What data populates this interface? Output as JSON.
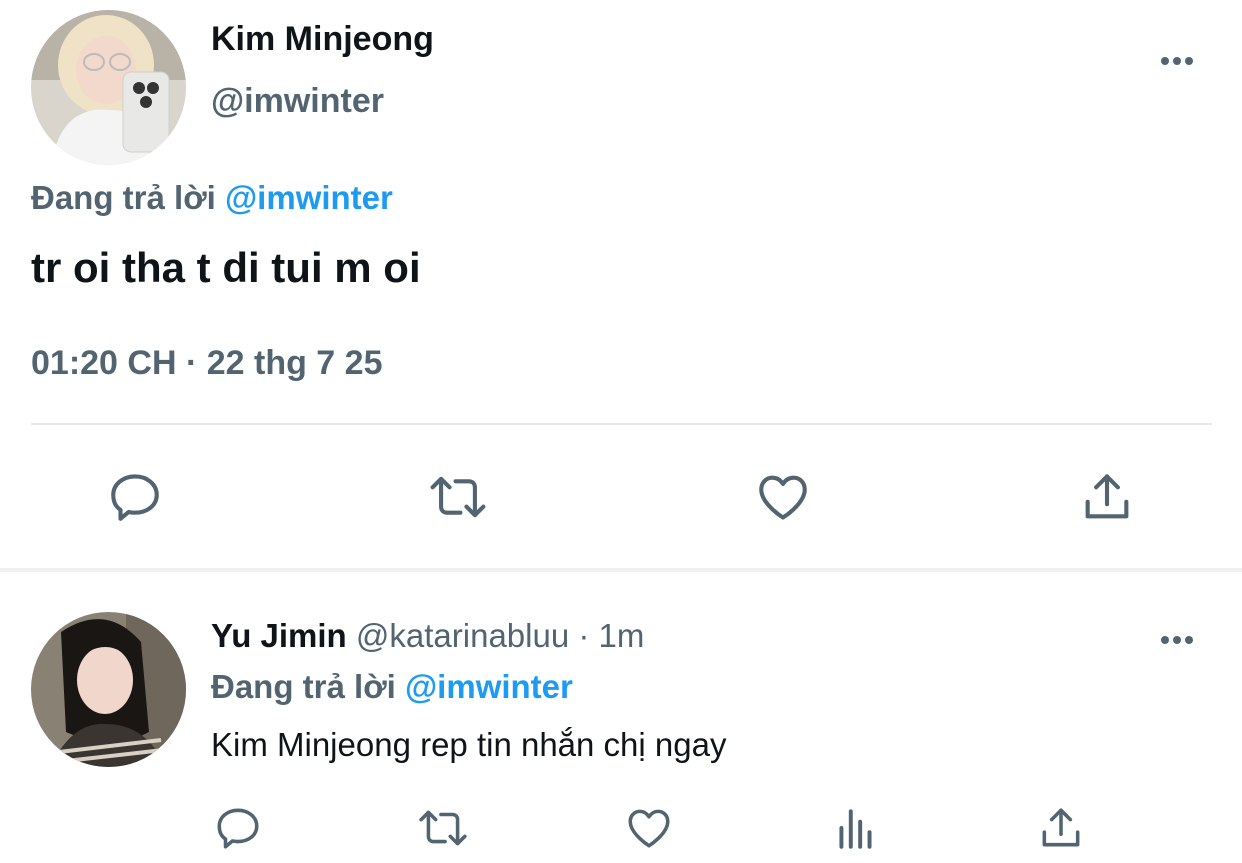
{
  "main_tweet": {
    "display_name": "Kim Minjeong",
    "handle": "@imwinter",
    "replying_prefix": "Đang trả lời",
    "replying_to": "@imwinter",
    "text": "tr oi tha t di tui m oi",
    "timestamp": "01:20 CH · 22 thg 7 25",
    "actions": [
      "reply-icon",
      "retweet-icon",
      "like-icon",
      "share-icon"
    ]
  },
  "reply_tweet": {
    "display_name": "Yu Jimin",
    "handle": "@katarinabluu",
    "separator": "·",
    "time_ago": "1m",
    "replying_prefix": "Đang trả lời",
    "replying_to": "@imwinter",
    "text": "Kim Minjeong rep tin nhắn chị ngay",
    "actions": [
      "reply-icon",
      "retweet-icon",
      "like-icon",
      "views-icon",
      "share-icon"
    ]
  },
  "colors": {
    "accent": "#1d9bf0",
    "secondary_text": "#536471",
    "primary_text": "#0f1419",
    "divider": "#e6e9eb"
  }
}
